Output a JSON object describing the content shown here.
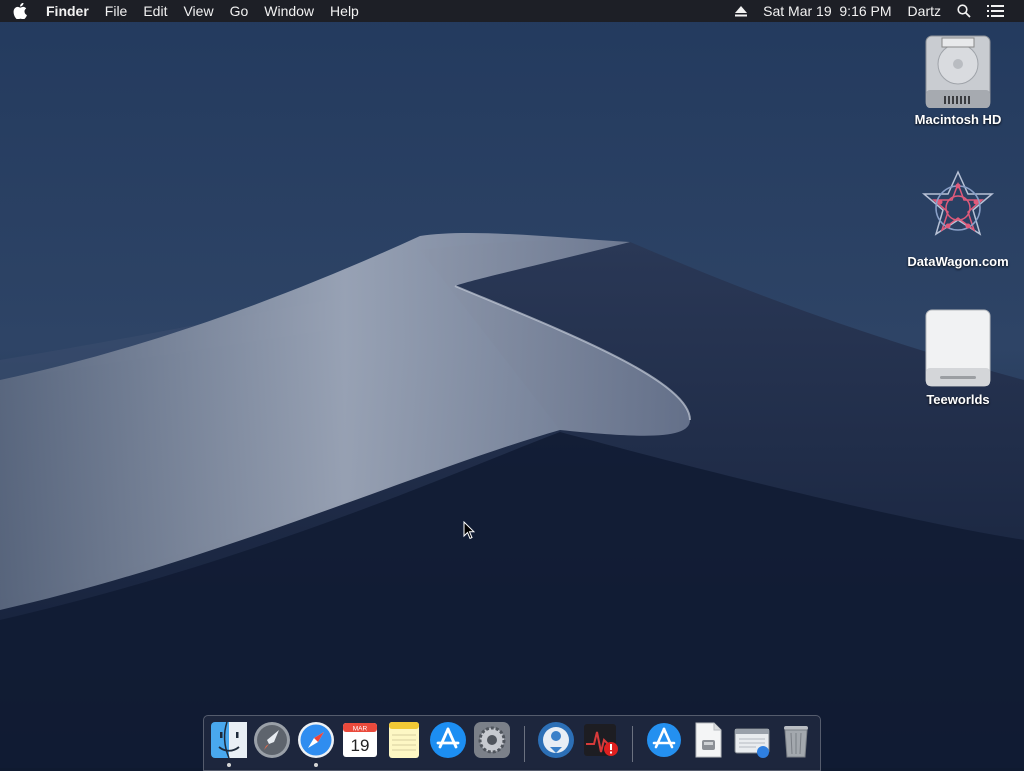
{
  "menubar": {
    "app_name": "Finder",
    "menus": [
      "File",
      "Edit",
      "View",
      "Go",
      "Window",
      "Help"
    ],
    "clock": "Sat Mar 19  9:16 PM",
    "user": "Dartz",
    "icons": [
      "apple-icon",
      "eject-icon",
      "spotlight-icon",
      "notification-center-icon"
    ]
  },
  "desktop": {
    "icons": [
      {
        "label": "Macintosh HD",
        "icon": "hard-drive-icon"
      },
      {
        "label": "DataWagon.com",
        "icon": "datawagon-disk-icon"
      },
      {
        "label": "Teeworlds",
        "icon": "external-drive-icon"
      }
    ]
  },
  "dock": {
    "apps": [
      {
        "name": "Finder",
        "icon": "finder-icon",
        "running": true
      },
      {
        "name": "Launchpad",
        "icon": "launchpad-icon",
        "running": false
      },
      {
        "name": "Safari",
        "icon": "safari-icon",
        "running": true
      },
      {
        "name": "Calendar",
        "icon": "calendar-icon",
        "running": false,
        "month": "MAR",
        "day": "19"
      },
      {
        "name": "Notes",
        "icon": "notes-icon",
        "running": false
      },
      {
        "name": "App Store",
        "icon": "app-store-icon",
        "running": false
      },
      {
        "name": "System Preferences",
        "icon": "system-preferences-icon",
        "running": false
      },
      {
        "name": "Downloader",
        "icon": "download-globe-icon",
        "running": false
      },
      {
        "name": "Activity",
        "icon": "activity-alert-icon",
        "running": false
      },
      {
        "name": "Applications",
        "icon": "applications-folder-icon",
        "running": false
      },
      {
        "name": "Document",
        "icon": "document-icon",
        "running": false
      },
      {
        "name": "Window",
        "icon": "window-stack-icon",
        "running": false
      },
      {
        "name": "Trash",
        "icon": "trash-icon",
        "running": false
      }
    ]
  },
  "colors": {
    "menubar_bg": "#1d1f26",
    "sky_top": "#1f3556",
    "sky_bottom": "#0f1a30",
    "dune": "#8d96a8"
  }
}
